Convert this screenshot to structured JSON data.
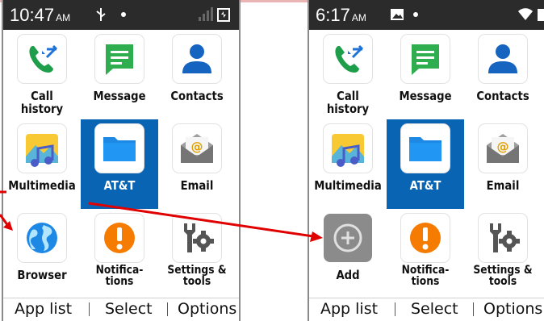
{
  "colors": {
    "accent": "#0a64b4",
    "statusbar": "#2b2b2b",
    "arrow": "#e00000"
  },
  "phones": [
    {
      "time": "10:47",
      "ampm": "AM",
      "status_icons": [
        "usb-icon",
        "dot-icon",
        "signal-icon",
        "battery-icon"
      ],
      "apps": [
        {
          "label": "Call history",
          "icon": "call-history-icon"
        },
        {
          "label": "Message",
          "icon": "message-icon"
        },
        {
          "label": "Contacts",
          "icon": "contacts-icon"
        },
        {
          "label": "Multimedia",
          "icon": "multimedia-icon"
        },
        {
          "label": "AT&T",
          "icon": "folder-icon",
          "selected": true
        },
        {
          "label": "Email",
          "icon": "email-icon"
        },
        {
          "label": "Browser",
          "icon": "globe-icon"
        },
        {
          "label": "Notifica-",
          "label2": "tions",
          "icon": "notification-icon"
        },
        {
          "label": "Settings &",
          "label2": "tools",
          "icon": "settings-tools-icon"
        }
      ],
      "softkeys": {
        "left": "App list",
        "center": "Select",
        "right": "Options"
      }
    },
    {
      "time": "6:17",
      "ampm": "AM",
      "status_icons": [
        "image-icon",
        "dot-icon",
        "wifi-icon",
        "battery-icon"
      ],
      "apps": [
        {
          "label": "Call history",
          "icon": "call-history-icon"
        },
        {
          "label": "Message",
          "icon": "message-icon"
        },
        {
          "label": "Contacts",
          "icon": "contacts-icon"
        },
        {
          "label": "Multimedia",
          "icon": "multimedia-icon"
        },
        {
          "label": "AT&T",
          "icon": "folder-icon",
          "selected": true
        },
        {
          "label": "Email",
          "icon": "email-icon"
        },
        {
          "label": "Add",
          "icon": "add-icon"
        },
        {
          "label": "Notifica-",
          "label2": "tions",
          "icon": "notification-icon"
        },
        {
          "label": "Settings &",
          "label2": "tools",
          "icon": "settings-tools-icon"
        }
      ],
      "softkeys": {
        "left": "App list",
        "center": "Select",
        "right": "Options"
      }
    }
  ]
}
